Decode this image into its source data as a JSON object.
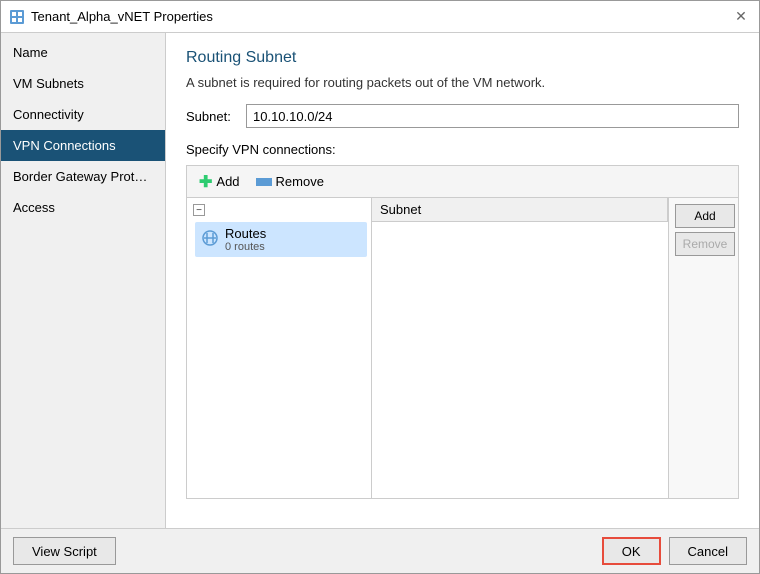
{
  "window": {
    "title": "Tenant_Alpha_vNET Properties",
    "close_label": "✕"
  },
  "sidebar": {
    "items": [
      {
        "id": "name",
        "label": "Name",
        "active": false
      },
      {
        "id": "vm-subnets",
        "label": "VM Subnets",
        "active": false
      },
      {
        "id": "connectivity",
        "label": "Connectivity",
        "active": false
      },
      {
        "id": "vpn-connections",
        "label": "VPN Connections",
        "active": true
      },
      {
        "id": "border-gateway",
        "label": "Border Gateway Protocol...",
        "active": false
      },
      {
        "id": "access",
        "label": "Access",
        "active": false
      }
    ]
  },
  "main": {
    "title": "Routing Subnet",
    "description": "A subnet is required for routing packets out of the VM network.",
    "subnet_label": "Subnet:",
    "subnet_value": "10.10.10.0/24",
    "vpn_label": "Specify VPN connections:",
    "toolbar": {
      "add_label": "Add",
      "remove_label": "Remove"
    },
    "tree": {
      "collapse_icon": "−",
      "routes_label": "Routes",
      "routes_sub": "0 routes"
    },
    "routes_table": {
      "col_subnet": "Subnet",
      "add_btn": "Add",
      "remove_btn": "Remove"
    }
  },
  "footer": {
    "view_script_label": "View Script",
    "ok_label": "OK",
    "cancel_label": "Cancel"
  },
  "icons": {
    "vpn": "⊞",
    "routes": "⚡",
    "add_plus": "+",
    "window_icon": "🖥"
  }
}
